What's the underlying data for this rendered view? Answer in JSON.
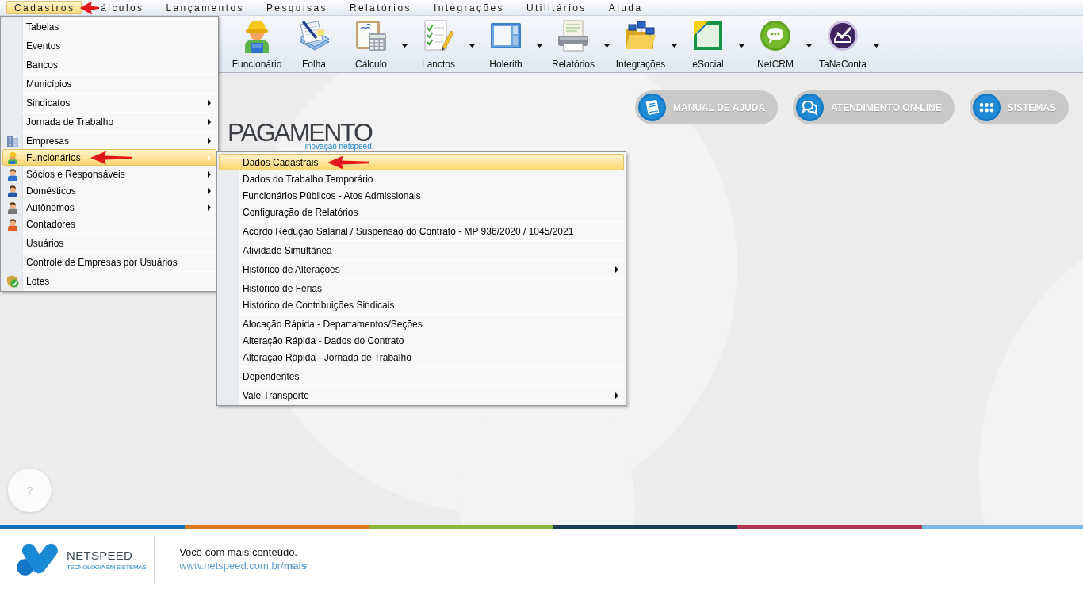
{
  "menu_bar": [
    {
      "label": "Cadastros",
      "selected": true
    },
    {
      "label": "álculos",
      "selected": false
    },
    {
      "label": "Lançamentos",
      "selected": false
    },
    {
      "label": "Pesquisas",
      "selected": false
    },
    {
      "label": "Relatórios",
      "selected": false
    },
    {
      "label": "Integrações",
      "selected": false
    },
    {
      "label": "Utilitários",
      "selected": false
    },
    {
      "label": "Ajuda",
      "selected": false
    }
  ],
  "cadastros_menu": [
    [
      {
        "label": "Tabelas",
        "selected": false,
        "submenu": false
      }
    ],
    [
      {
        "label": "Eventos",
        "selected": false,
        "submenu": false
      }
    ],
    [
      {
        "label": "Bancos",
        "selected": false,
        "submenu": false
      }
    ],
    [
      {
        "label": "Municípios",
        "selected": false,
        "submenu": false
      }
    ],
    [
      {
        "label": "Sindicatos",
        "selected": false,
        "submenu": true
      }
    ],
    [
      {
        "label": "Jornada de Trabalho",
        "selected": false,
        "submenu": true
      }
    ],
    [
      {
        "label": "Empresas",
        "selected": false,
        "submenu": true
      },
      {
        "label": "Funcionários",
        "selected": true,
        "submenu": true
      },
      {
        "label": "Sócios e Responsáveis",
        "selected": false,
        "submenu": true,
        "color": "#2f6fcf"
      },
      {
        "label": "Domésticos",
        "selected": false,
        "submenu": true,
        "color": "#2358a8"
      },
      {
        "label": "Autônomos",
        "selected": false,
        "submenu": true,
        "color": "#767676"
      },
      {
        "label": "Contadores",
        "selected": false,
        "submenu": false,
        "color": "#e0602a"
      }
    ],
    [
      {
        "label": "Usuários",
        "selected": false,
        "submenu": false
      }
    ],
    [
      {
        "label": "Controle de Empresas por Usuários",
        "selected": false,
        "submenu": false
      }
    ],
    [
      {
        "label": "Lotes",
        "selected": false,
        "submenu": false
      }
    ]
  ],
  "funcionarios_submenu": [
    [
      {
        "label": "Dados Cadastrais",
        "selected": true,
        "submenu": false
      },
      {
        "label": "Dados do Trabalho Temporário",
        "selected": false,
        "submenu": false
      },
      {
        "label": "Funcionários Públicos - Atos Admissionais",
        "selected": false,
        "submenu": false
      },
      {
        "label": "Configuração de Relatórios",
        "selected": false,
        "submenu": false
      }
    ],
    [
      {
        "label": "Acordo Redução Salarial / Suspensão do Contrato - MP 936/2020 / 1045/2021",
        "selected": false,
        "submenu": false
      }
    ],
    [
      {
        "label": "Atividade Simultânea",
        "selected": false,
        "submenu": false
      }
    ],
    [
      {
        "label": "Histórico de Alterações",
        "selected": false,
        "submenu": true
      }
    ],
    [
      {
        "label": "Histórico de Férias",
        "selected": false,
        "submenu": false
      },
      {
        "label": "Histórico de Contribuições Sindicais",
        "selected": false,
        "submenu": false
      }
    ],
    [
      {
        "label": "Alocação Rápida - Departamentos/Seções",
        "selected": false,
        "submenu": false
      },
      {
        "label": "Alteração Rápida - Dados do Contrato",
        "selected": false,
        "submenu": false
      },
      {
        "label": "Alteração Rápida - Jornada de Trabalho",
        "selected": false,
        "submenu": false
      }
    ],
    [
      {
        "label": "Dependentes",
        "selected": false,
        "submenu": false
      }
    ],
    [
      {
        "label": "Vale Transporte",
        "selected": false,
        "submenu": true
      }
    ]
  ],
  "toolbar": [
    {
      "label": "Funcionário",
      "dropdown": false
    },
    {
      "label": "Folha",
      "dropdown": false
    },
    {
      "label": "Cálculo",
      "dropdown": true
    },
    {
      "label": "Lanctos",
      "dropdown": true
    },
    {
      "label": "Holerith",
      "dropdown": true
    },
    {
      "label": "Relatórios",
      "dropdown": true
    },
    {
      "label": "Integrações",
      "dropdown": true
    },
    {
      "label": "eSocial",
      "dropdown": true
    },
    {
      "label": "NetCRM",
      "dropdown": true
    },
    {
      "label": "TaNaConta",
      "dropdown": true
    }
  ],
  "shortcuts": [
    {
      "label": "MANUAL DE AJUDA"
    },
    {
      "label": "ATENDIMENTO ON-LINE"
    },
    {
      "label": "SISTEMAS"
    }
  ],
  "app_logo": {
    "title": "PAGAMENTO",
    "tagline": "inovação netspeed"
  },
  "help_button": {
    "label": "?"
  },
  "footer": {
    "brand": "NETSPEED",
    "brand_tagline": "TECNOLOGIA EM SISTEMAS",
    "message": "Você com mais conteúdo.",
    "link": "www.netspeed.com.br/**mais**"
  }
}
